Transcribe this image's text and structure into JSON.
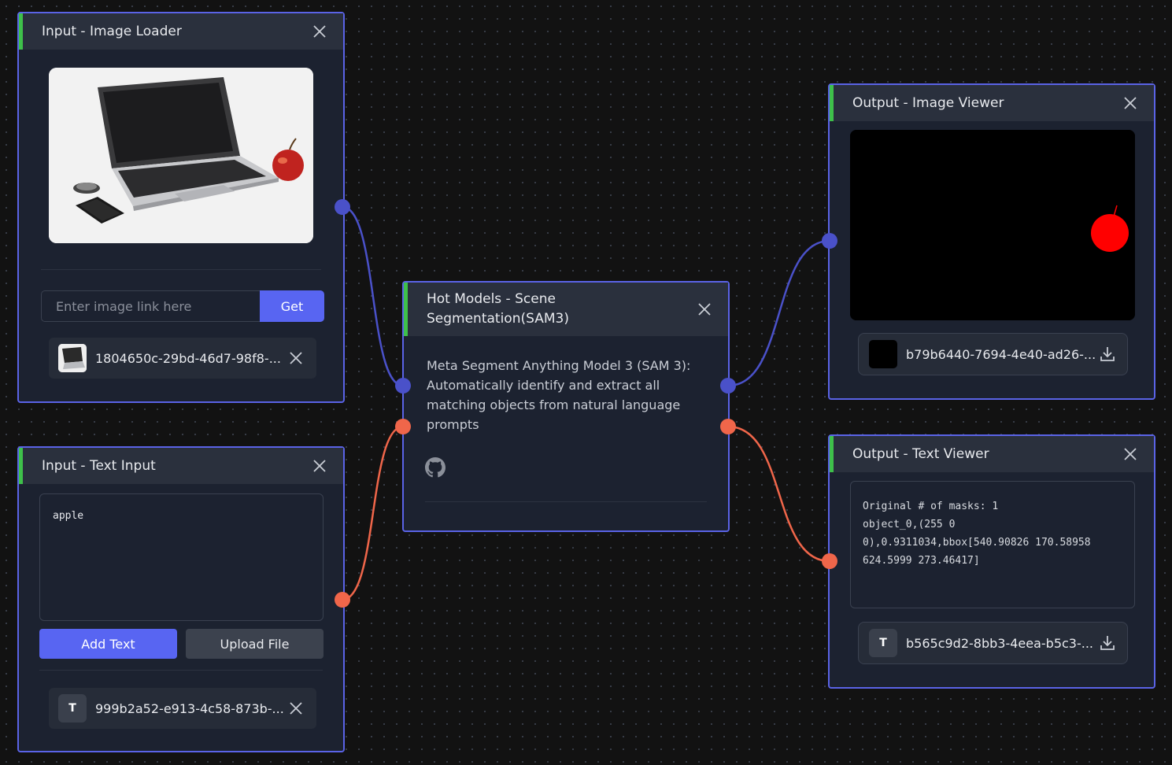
{
  "colors": {
    "canvas_bg": "#121212",
    "node_bg": "#1c2230",
    "node_border": "#5a63e6",
    "header_accent": "#3ec04a",
    "button_primary": "#5865f2",
    "image_edge": "#4a51c9",
    "text_edge": "#f0664a"
  },
  "image_loader": {
    "title": "Input - Image Loader",
    "url_placeholder": "Enter image link here",
    "get_label": "Get",
    "file_name": "1804650c-29bd-46d7-98f8-..."
  },
  "text_input": {
    "title": "Input - Text Input",
    "text_value": "apple",
    "add_text_label": "Add Text",
    "upload_file_label": "Upload File",
    "file_type_badge": "T",
    "file_name": "999b2a52-e913-4c58-873b-..."
  },
  "model": {
    "title_line1": "Hot Models - Scene",
    "title_line2": "Segmentation(SAM3)",
    "description": "Meta Segment Anything Model 3 (SAM 3): Automatically identify and extract all matching objects from natural language prompts",
    "link_icon": "github-icon"
  },
  "image_viewer": {
    "title": "Output - Image Viewer",
    "file_name": "b79b6440-7694-4e40-ad26-..."
  },
  "text_viewer": {
    "title": "Output - Text Viewer",
    "output_text": "Original # of masks: 1\nobject_0,(255 0 0),0.9311034,bbox[540.90826 170.58958 624.5999 273.46417]",
    "file_type_badge": "T",
    "file_name": "b565c9d2-8bb3-4eea-b5c3-..."
  }
}
